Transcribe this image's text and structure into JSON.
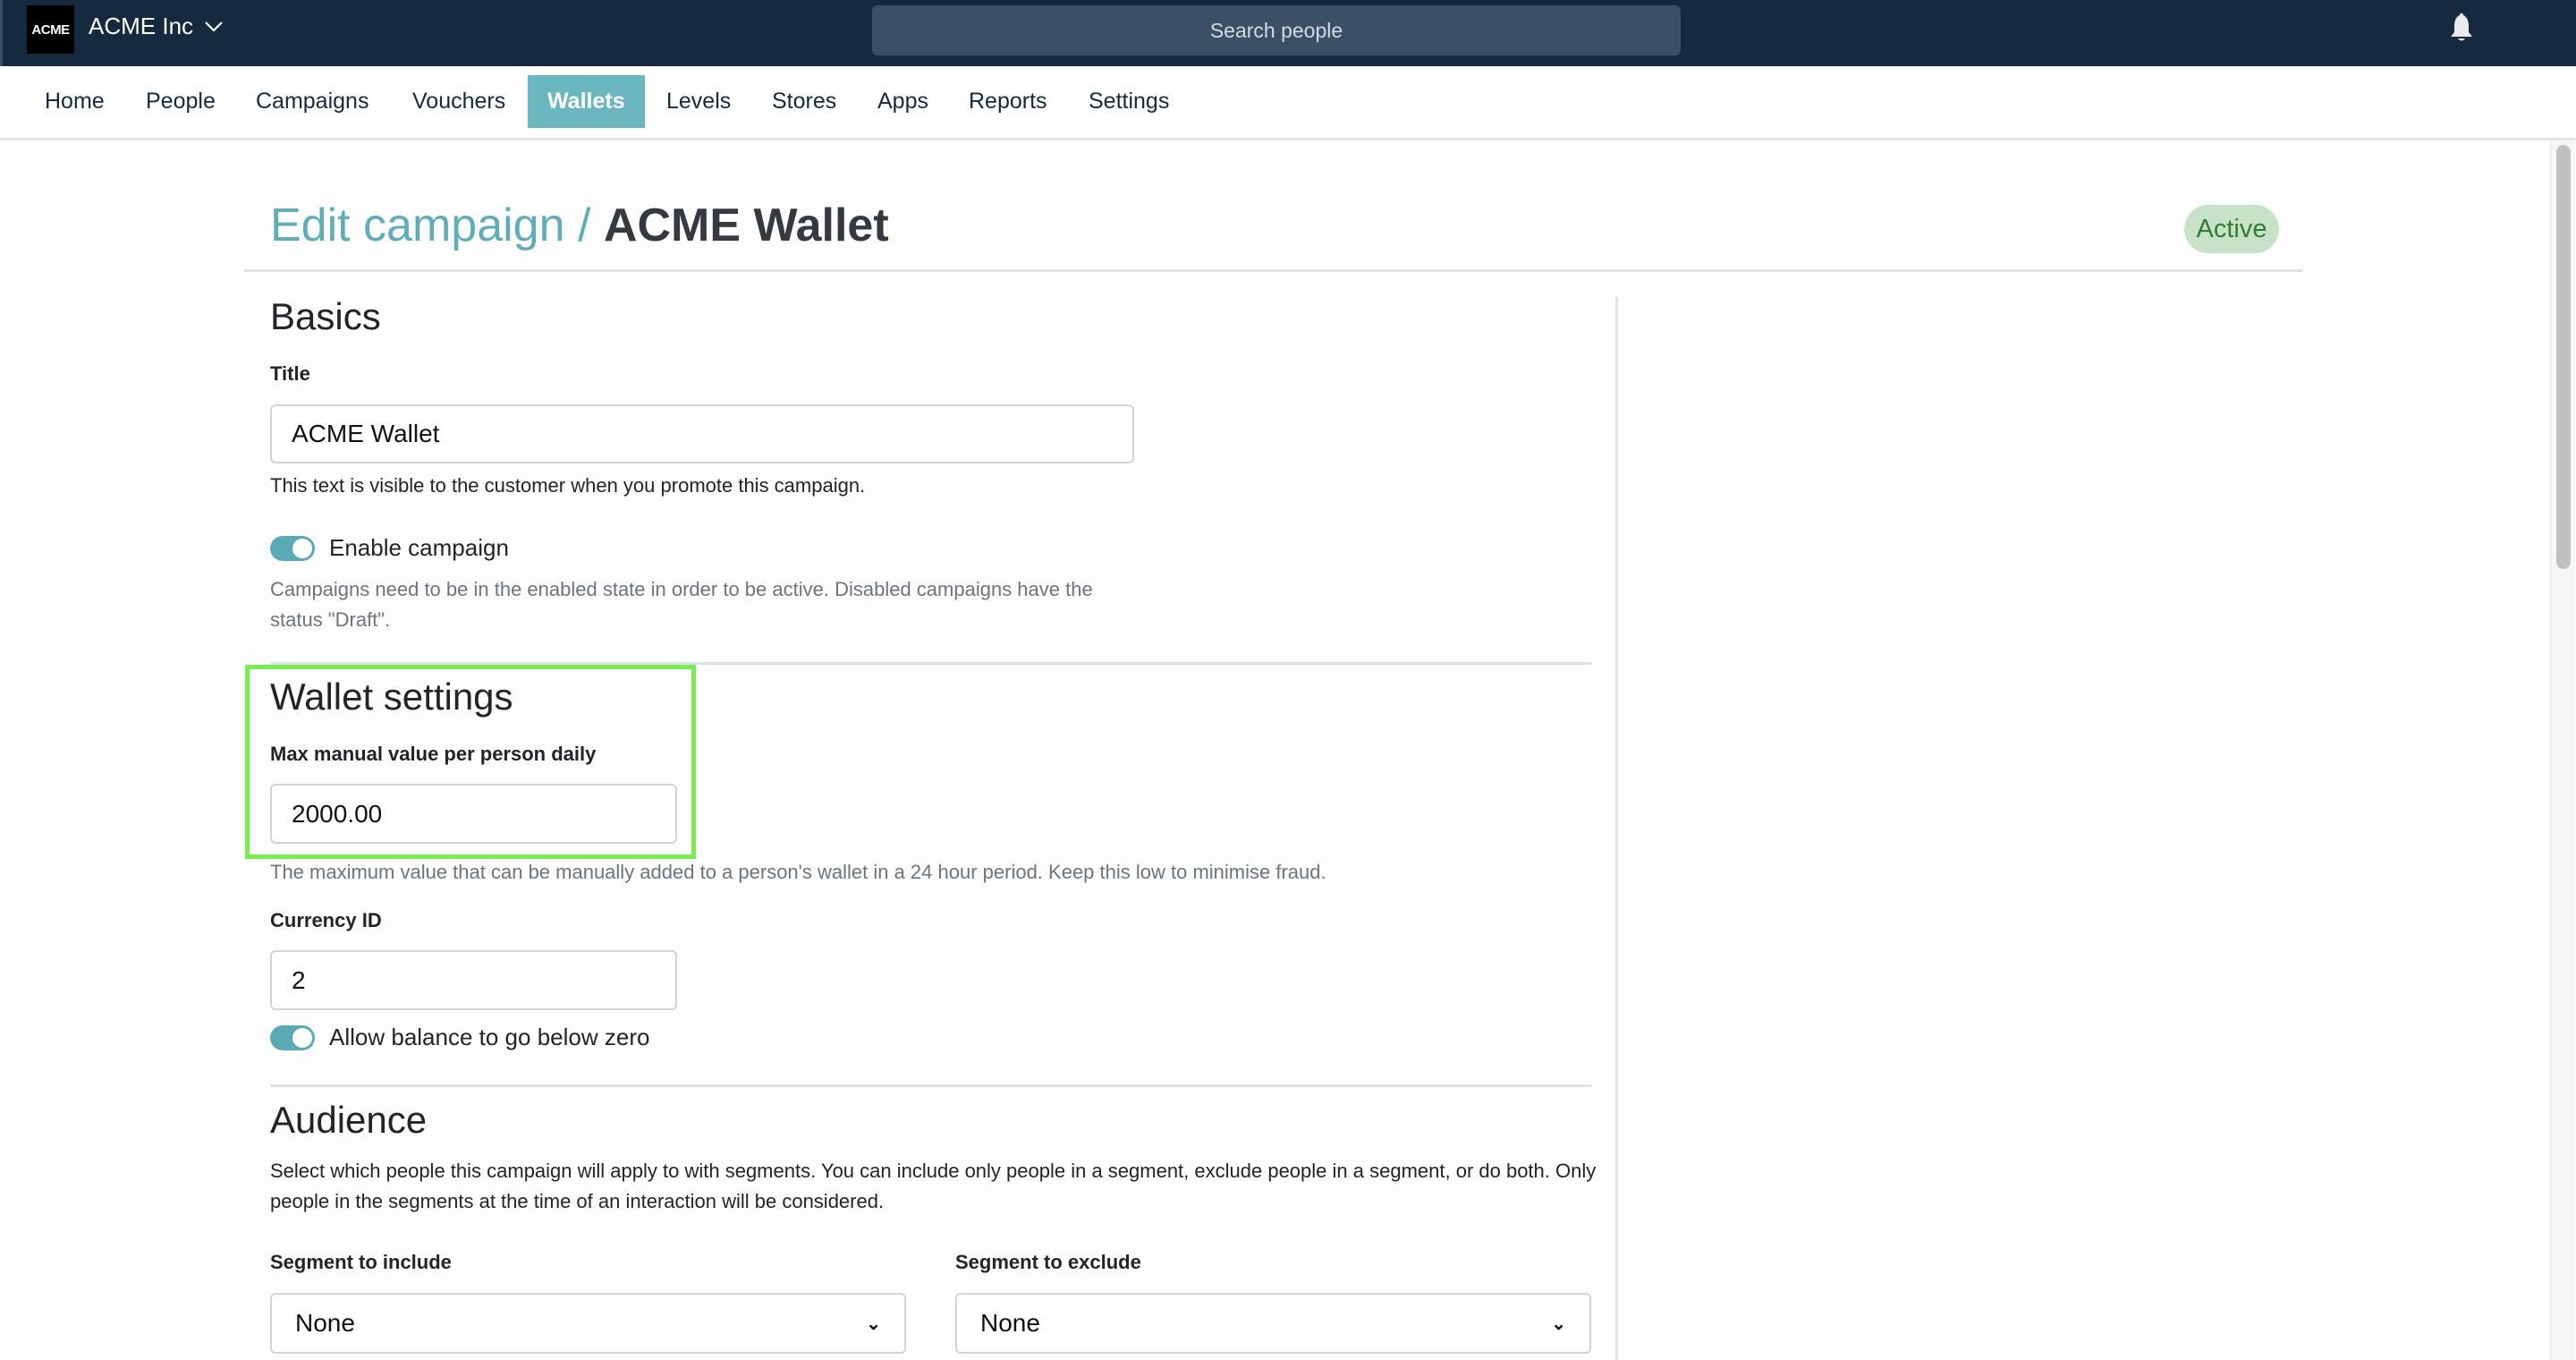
{
  "header": {
    "logo_text": "ACME",
    "org_name": "ACME Inc",
    "search_placeholder": "Search people"
  },
  "nav": {
    "items": [
      {
        "label": "Home"
      },
      {
        "label": "People"
      },
      {
        "label": "Campaigns"
      },
      {
        "label": "Vouchers"
      },
      {
        "label": "Wallets",
        "active": true
      },
      {
        "label": "Levels"
      },
      {
        "label": "Stores"
      },
      {
        "label": "Apps"
      },
      {
        "label": "Reports"
      },
      {
        "label": "Settings"
      }
    ]
  },
  "page": {
    "breadcrumb": "Edit campaign",
    "separator": "/",
    "campaign_name": "ACME Wallet",
    "status": "Active"
  },
  "basics": {
    "heading": "Basics",
    "title_label": "Title",
    "title_value": "ACME Wallet",
    "title_help": "This text is visible to the customer when you promote this campaign.",
    "enable_label": "Enable campaign",
    "enable_on": true,
    "enable_help": "Campaigns need to be in the enabled state in order to be active. Disabled campaigns have the status \"Draft\"."
  },
  "wallet": {
    "heading": "Wallet settings",
    "max_label": "Max manual value per person daily",
    "max_value": "2000.00",
    "max_help": "The maximum value that can be manually added to a person's wallet in a 24 hour period. Keep this low to minimise fraud.",
    "currency_label": "Currency ID",
    "currency_value": "2",
    "negative_label": "Allow balance to go below zero",
    "negative_on": true
  },
  "audience": {
    "heading": "Audience",
    "description": "Select which people this campaign will apply to with segments. You can include only people in a segment, exclude people in a segment, or do both. Only people in the segments at the time of an interaction will be considered.",
    "include_label": "Segment to include",
    "include_value": "None",
    "exclude_label": "Segment to exclude",
    "exclude_value": "None"
  },
  "colors": {
    "header_bg": "#15293f",
    "accent": "#6bb7c0",
    "status_bg": "#c8e2c8",
    "status_text": "#2e7d32",
    "highlight": "#77ee4f"
  }
}
